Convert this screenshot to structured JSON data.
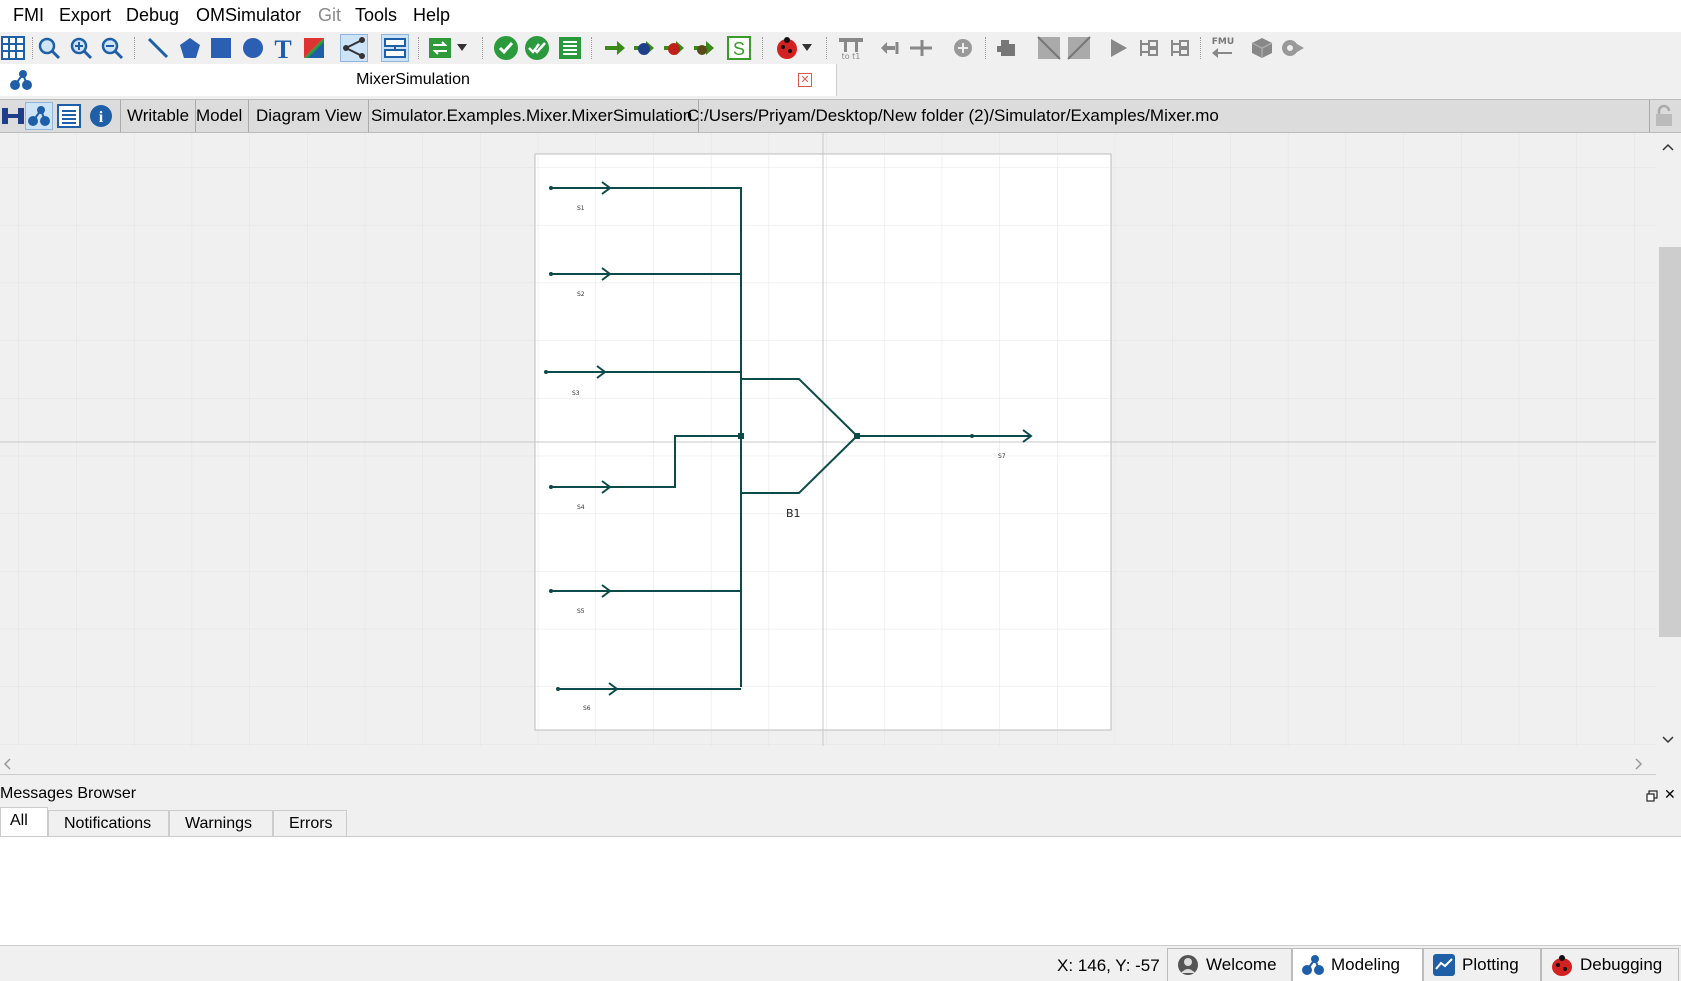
{
  "menu": {
    "items": [
      {
        "label": "FMI",
        "enabled": true
      },
      {
        "label": "Export",
        "enabled": true
      },
      {
        "label": "Debug",
        "enabled": true
      },
      {
        "label": "OMSimulator",
        "enabled": true
      },
      {
        "label": "Git",
        "enabled": false
      },
      {
        "label": "Tools",
        "enabled": true
      },
      {
        "label": "Help",
        "enabled": true
      }
    ]
  },
  "document": {
    "title": "MixerSimulation"
  },
  "info_bar": {
    "writable": "Writable",
    "type": "Model",
    "view": "Diagram View",
    "class_name": "Simulator.Examples.Mixer.MixerSimulation",
    "file_path": "C:/Users/Priyam/Desktop/New folder (2)/Simulator/Examples/Mixer.mo"
  },
  "diagram": {
    "inputs": [
      "S1",
      "S2",
      "S3",
      "S4",
      "S5",
      "S6"
    ],
    "mixer_label": "B1",
    "output": "S7"
  },
  "messages": {
    "title": "Messages Browser",
    "tabs": [
      "All",
      "Notifications",
      "Warnings",
      "Errors"
    ],
    "active_tab": "All"
  },
  "status": {
    "coords": "X: 146, Y: -57"
  },
  "perspectives": [
    "Welcome",
    "Modeling",
    "Plotting",
    "Debugging"
  ],
  "active_perspective": "Modeling",
  "colors": {
    "connection": "#0d4a4a",
    "grid": "#e2e2e2",
    "canvas": "#f0f0f0",
    "diagram_bg": "#ffffff"
  }
}
